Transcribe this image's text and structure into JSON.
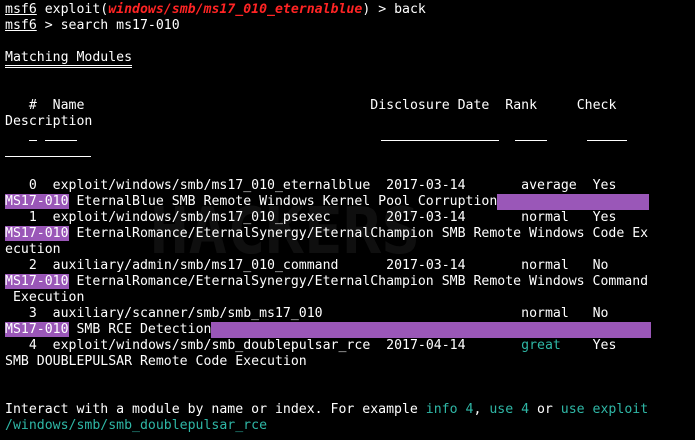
{
  "prompt1": {
    "name": "msf6",
    "pre": " exploit(",
    "module": "windows/smb/ms17_010_eternalblue",
    "post": ") > ",
    "command": "back"
  },
  "prompt2": {
    "name": "msf6",
    "text": " > search ms17-010"
  },
  "section_title": "Matching Modules",
  "headers": {
    "num": "#",
    "name": "Name",
    "date": "Disclosure Date",
    "rank": "Rank",
    "check": "Check",
    "description": "Description"
  },
  "search_term": "MS17-010",
  "modules": [
    {
      "num": "0",
      "name": "exploit/windows/smb/ms17_010_eternalblue",
      "date": "2017-03-14",
      "rank": "average",
      "check": "Yes",
      "desc_lines": [
        " EternalBlue SMB Remote Windows Kernel Pool Corruption"
      ]
    },
    {
      "num": "1",
      "name": "exploit/windows/smb/ms17_010_psexec",
      "date": "2017-03-14",
      "rank": "normal",
      "check": "Yes",
      "desc_lines": [
        " EternalRomance/EternalSynergy/EternalChampion SMB Remote Windows Code Ex",
        "ecution"
      ]
    },
    {
      "num": "2",
      "name": "auxiliary/admin/smb/ms17_010_command",
      "date": "2017-03-14",
      "rank": "normal",
      "check": "No",
      "desc_lines": [
        " EternalRomance/EternalSynergy/EternalChampion SMB Remote Windows Command",
        " Execution"
      ]
    },
    {
      "num": "3",
      "name": "auxiliary/scanner/smb/smb_ms17_010",
      "date": "",
      "rank": "normal",
      "check": "No",
      "desc_lines": [
        " SMB RCE Detection"
      ]
    },
    {
      "num": "4",
      "name": "exploit/windows/smb/smb_doublepulsar_rce",
      "date": "2017-04-14",
      "rank": "great",
      "check": "Yes",
      "desc_lines": [
        "SMB DOUBLEPULSAR Remote Code Execution"
      ]
    }
  ],
  "footer": {
    "text1": "Interact with a module by name or index. For example ",
    "info": "info 4",
    "comma": ", ",
    "use": "use 4",
    "or": " or ",
    "use_exploit": "use exploit",
    "path": "/windows/smb/smb_doublepulsar_rce"
  },
  "colors": {
    "highlight": "#9a57b8",
    "accent_teal": "#2fb7a6",
    "prompt_red": "#ff2424"
  }
}
